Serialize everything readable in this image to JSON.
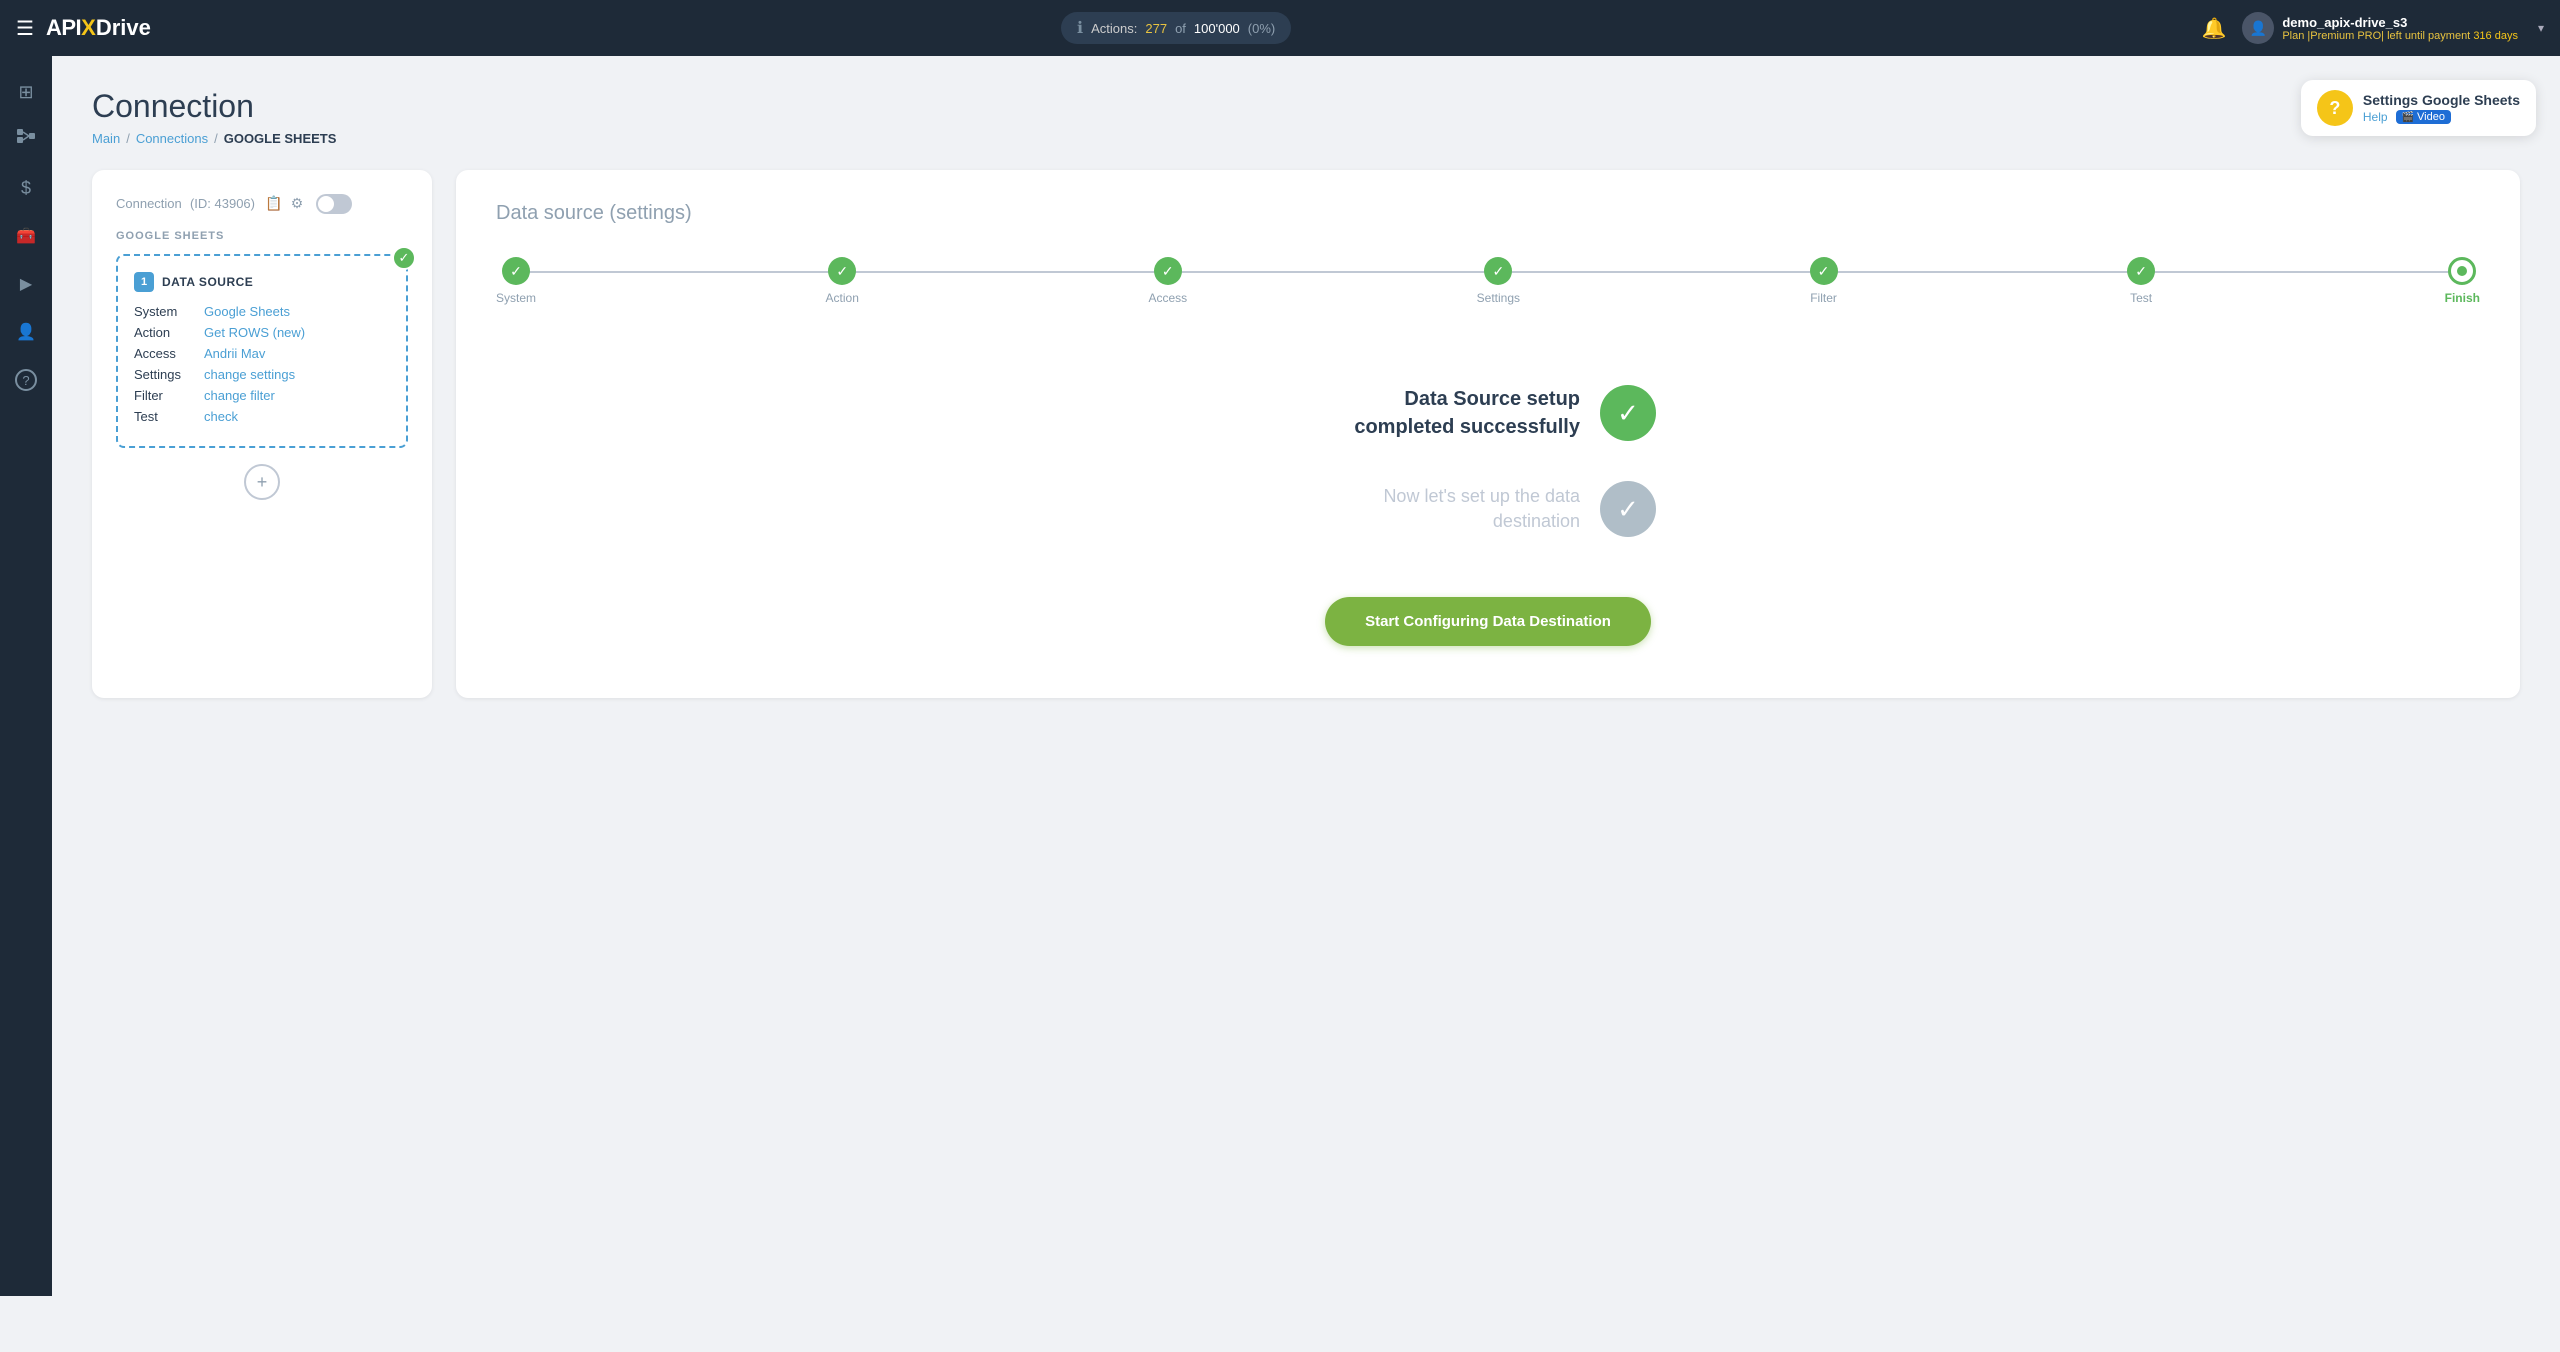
{
  "topnav": {
    "logo_api": "API",
    "logo_x": "X",
    "logo_drive": "Drive",
    "actions_label": "Actions:",
    "actions_count": "277",
    "actions_total": "100'000",
    "actions_pct": "(0%)",
    "user_name": "demo_apix-drive_s3",
    "user_plan": "Plan |Premium PRO| left until payment",
    "user_days": "316 days"
  },
  "sidebar": {
    "items": [
      {
        "icon": "⊞",
        "name": "home-icon"
      },
      {
        "icon": "⣿",
        "name": "flow-icon"
      },
      {
        "icon": "$",
        "name": "billing-icon"
      },
      {
        "icon": "🧰",
        "name": "tools-icon"
      },
      {
        "icon": "▶",
        "name": "play-icon"
      },
      {
        "icon": "👤",
        "name": "user-icon"
      },
      {
        "icon": "?",
        "name": "help-icon"
      }
    ]
  },
  "breadcrumb": {
    "main": "Main",
    "connections": "Connections",
    "current": "GOOGLE SHEETS"
  },
  "page_title": "Connection",
  "help": {
    "title": "Settings Google Sheets",
    "help_label": "Help",
    "video_label": "Video"
  },
  "left_panel": {
    "header_label": "Connection",
    "id_label": "(ID: 43906)",
    "google_sheets_label": "GOOGLE SHEETS",
    "source_card": {
      "number": "1",
      "title": "DATA SOURCE",
      "rows": [
        {
          "key": "System",
          "value": "Google Sheets"
        },
        {
          "key": "Action",
          "value": "Get ROWS (new)"
        },
        {
          "key": "Access",
          "value": "Andrii Mav"
        },
        {
          "key": "Settings",
          "value": "change settings"
        },
        {
          "key": "Filter",
          "value": "change filter"
        },
        {
          "key": "Test",
          "value": "check"
        }
      ]
    },
    "add_btn_label": "+"
  },
  "right_panel": {
    "title": "Data source",
    "title_sub": "(settings)",
    "steps": [
      {
        "label": "System",
        "done": true
      },
      {
        "label": "Action",
        "done": true
      },
      {
        "label": "Access",
        "done": true
      },
      {
        "label": "Settings",
        "done": true
      },
      {
        "label": "Filter",
        "done": true
      },
      {
        "label": "Test",
        "done": true
      },
      {
        "label": "Finish",
        "active": true
      }
    ],
    "success_title": "Data Source setup completed successfully",
    "pending_title": "Now let's set up the data destination",
    "start_btn_label": "Start Configuring Data Destination"
  }
}
